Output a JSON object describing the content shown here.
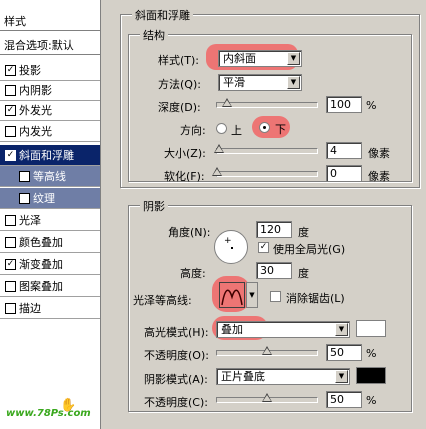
{
  "left_panel": {
    "header": "样式",
    "blend_header": "混合选项:默认",
    "items": [
      {
        "label": "投影",
        "checked": true
      },
      {
        "label": "内阴影",
        "checked": false
      },
      {
        "label": "外发光",
        "checked": true
      },
      {
        "label": "内发光",
        "checked": false
      },
      {
        "label": "斜面和浮雕",
        "checked": true
      },
      {
        "label": "等高线",
        "checked": false
      },
      {
        "label": "纹理",
        "checked": false
      },
      {
        "label": "光泽",
        "checked": false
      },
      {
        "label": "颜色叠加",
        "checked": false
      },
      {
        "label": "渐变叠加",
        "checked": true
      },
      {
        "label": "图案叠加",
        "checked": false
      },
      {
        "label": "描边",
        "checked": false
      }
    ],
    "check_mark": "☑"
  },
  "bevel": {
    "title": "斜面和浮雕",
    "structure_title": "结构",
    "style_label": "样式(T):",
    "style_value": "内斜面",
    "method_label": "方法(Q):",
    "method_value": "平滑",
    "depth_label": "深度(D):",
    "depth_value": "100",
    "depth_unit": "%",
    "depth_level": 0.1,
    "direction_label": "方向:",
    "direction_up": "上",
    "direction_down": "下",
    "size_label": "大小(Z):",
    "size_value": "4",
    "size_unit": "像素",
    "size_level": 0.02,
    "soften_label": "软化(F):",
    "soften_value": "0",
    "soften_unit": "像素",
    "soften_level": 0
  },
  "shading": {
    "title": "阴影",
    "angle_label": "角度(N):",
    "angle_value": "120",
    "angle_unit": "度",
    "global_light_label": "使用全局光(G)",
    "altitude_label": "高度:",
    "altitude_value": "30",
    "altitude_unit": "度",
    "gloss_contour_label": "光泽等高线:",
    "anti_alias_label": "消除锯齿(L)",
    "highlight_mode_label": "高光模式(H):",
    "highlight_mode_value": "叠加",
    "highlight_color": "#ffffff",
    "highlight_opacity_label": "不透明度(O):",
    "highlight_opacity_value": "50",
    "highlight_opacity_level": 0.5,
    "shadow_mode_label": "阴影模式(A):",
    "shadow_mode_value": "正片叠底",
    "shadow_color": "#000000",
    "shadow_opacity_label": "不透明度(C):",
    "shadow_opacity_value": "50",
    "shadow_opacity_level": 0.5,
    "percent": "%"
  },
  "watermark": "www.78Ps.com",
  "highlight_color": "#f06a6a"
}
